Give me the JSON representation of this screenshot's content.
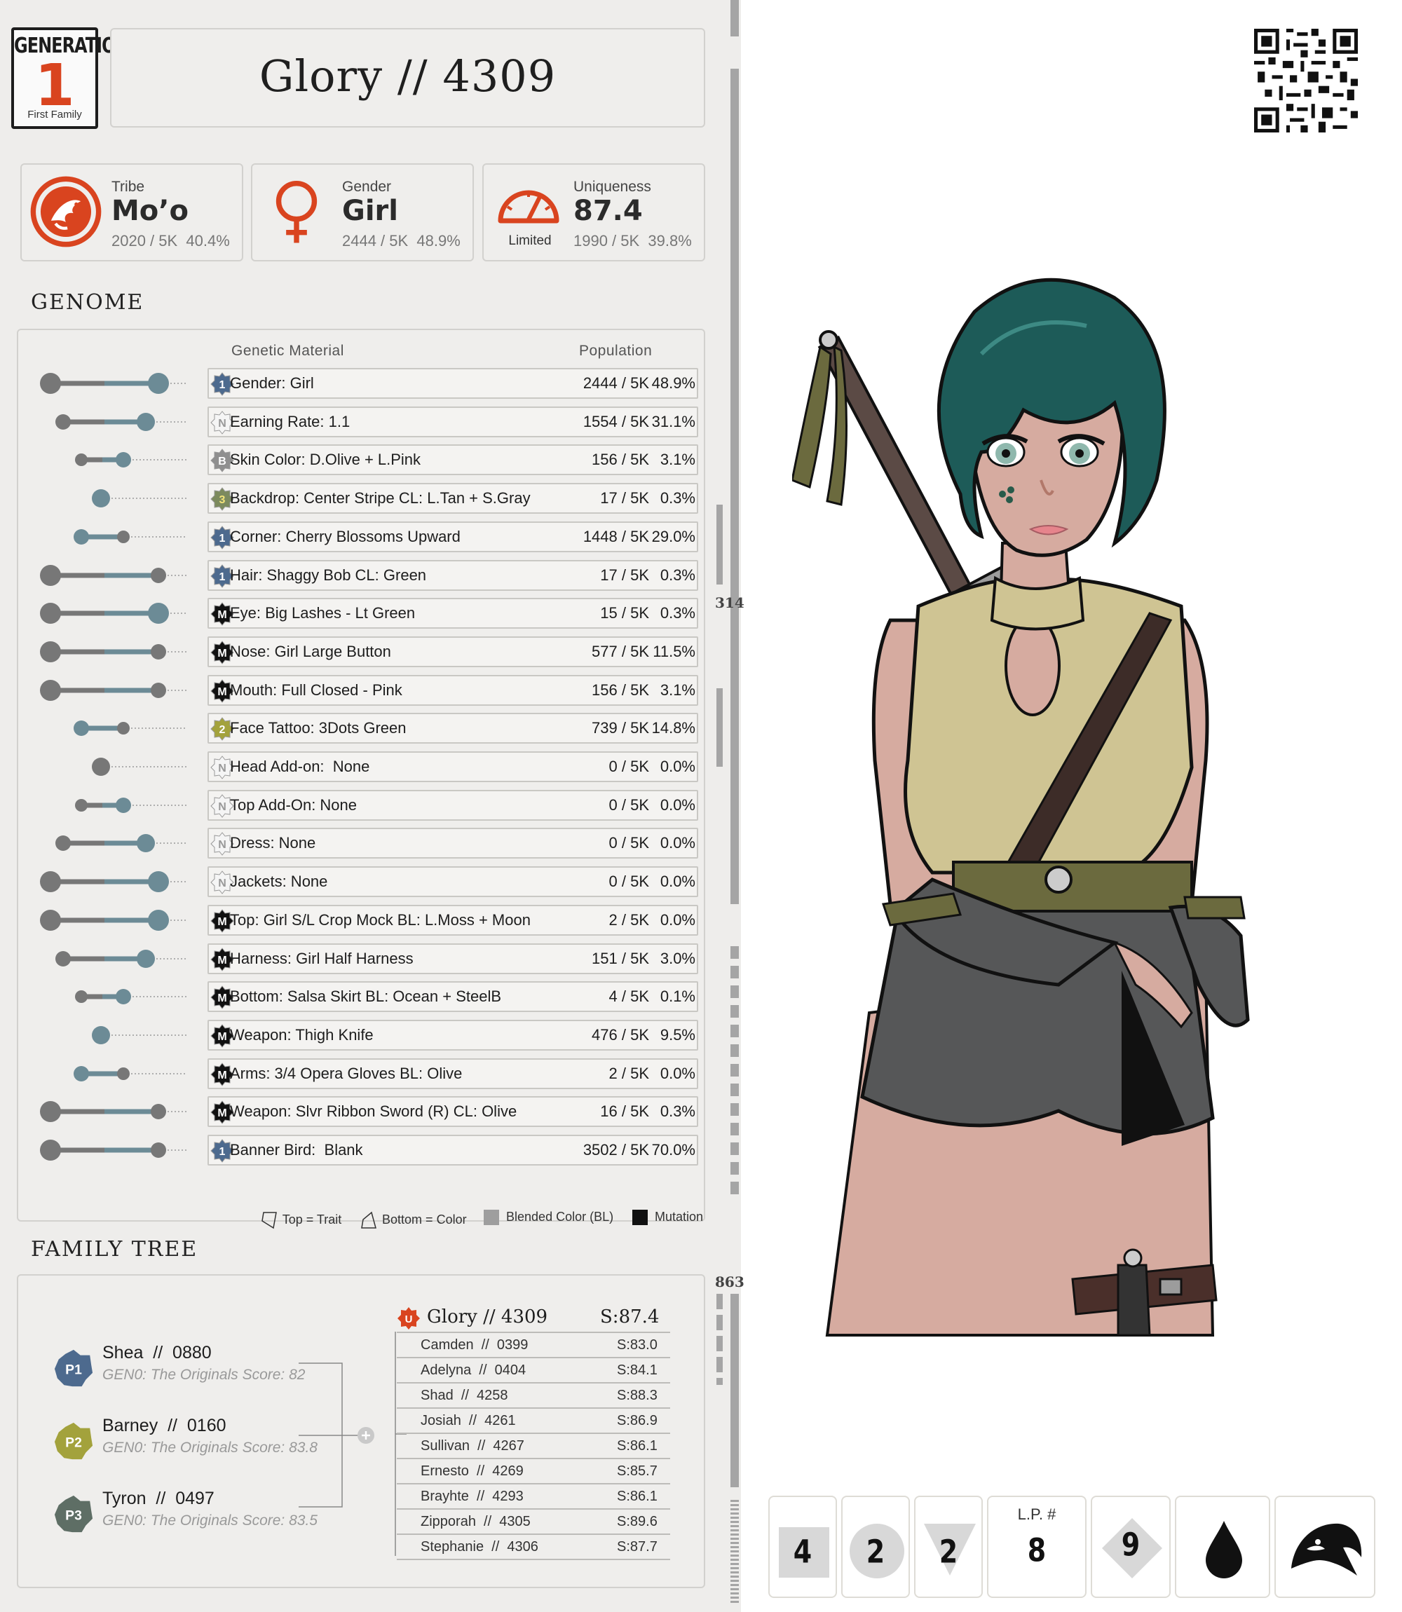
{
  "header": {
    "generation_label": "GENERATION",
    "generation_number": "1",
    "generation_sub": "First Family",
    "title": "Glory // 4309"
  },
  "stats": {
    "tribe": {
      "label": "Tribe",
      "value": "Mo’o",
      "count": "2020 / 5K",
      "pct": "40.4%",
      "icon": "lizard-emblem-icon"
    },
    "gender": {
      "label": "Gender",
      "value": "Girl",
      "count": "2444 / 5K",
      "pct": "48.9%",
      "icon": "female-symbol-icon"
    },
    "uniqueness": {
      "label": "Uniqueness",
      "value": "87.4",
      "count": "1990 / 5K",
      "pct": "39.8%",
      "tier": "Limited",
      "icon": "gauge-icon"
    }
  },
  "genome": {
    "section_title": "GENOME",
    "col_material": "Genetic Material",
    "col_population": "Population",
    "rows": [
      {
        "name": "Gender: Girl",
        "count": "2444 / 5K",
        "pct": "48.9%",
        "badge": "1",
        "badge_color": "#4d6a8e",
        "badge_text": "#ffffff",
        "dots": [
          1,
          0,
          1
        ]
      },
      {
        "name": "Earning Rate: 1.1",
        "count": "1554 / 5K",
        "pct": "31.1%",
        "badge": "N",
        "badge_color": "#f5f5f5",
        "badge_text": "#999999",
        "dots": [
          0,
          1,
          1
        ]
      },
      {
        "name": "Skin Color: D.Olive + L.Pink",
        "count": "156 / 5K",
        "pct": "3.1%",
        "badge": "B",
        "badge_color": "#8f8f8f",
        "badge_text": "#ffffff",
        "dots": [
          0,
          2,
          1
        ]
      },
      {
        "name": "Backdrop: Center Stripe CL: L.Tan + S.Gray",
        "count": "17 / 5K",
        "pct": "0.3%",
        "badge": "3",
        "badge_color": "#7c8a5e",
        "badge_text": "#f2e37a",
        "dots": [
          0,
          3,
          3
        ]
      },
      {
        "name": "Corner: Cherry Blossoms Upward",
        "count": "1448 / 5K",
        "pct": "29.0%",
        "badge": "1",
        "badge_color": "#4d6a8e",
        "badge_text": "#ffffff",
        "dots": [
          2,
          2,
          0
        ]
      },
      {
        "name": "Hair: Shaggy Bob CL: Green",
        "count": "17 / 5K",
        "pct": "0.3%",
        "badge": "1",
        "badge_color": "#4d6a8e",
        "badge_text": "#ffffff",
        "dots": [
          1,
          0,
          0
        ]
      },
      {
        "name": "Eye: Big Lashes - Lt Green",
        "count": "15 / 5K",
        "pct": "0.3%",
        "badge": "M",
        "badge_color": "#111111",
        "badge_text": "#ffffff",
        "dots": [
          1,
          0,
          1
        ]
      },
      {
        "name": "Nose: Girl Large Button",
        "count": "577 / 5K",
        "pct": "11.5%",
        "badge": "M",
        "badge_color": "#111111",
        "badge_text": "#ffffff",
        "dots": [
          1,
          0,
          0
        ]
      },
      {
        "name": "Mouth: Full Closed - Pink",
        "count": "156 / 5K",
        "pct": "3.1%",
        "badge": "M",
        "badge_color": "#111111",
        "badge_text": "#ffffff",
        "dots": [
          1,
          0,
          0
        ]
      },
      {
        "name": "Face Tattoo: 3Dots Green",
        "count": "739 / 5K",
        "pct": "14.8%",
        "badge": "2",
        "badge_color": "#a3a23c",
        "badge_text": "#ffffff",
        "dots": [
          2,
          2,
          0
        ]
      },
      {
        "name": "Head Add-on:  None",
        "count": "0 / 5K",
        "pct": "0.0%",
        "badge": "N",
        "badge_color": "#f5f5f5",
        "badge_text": "#999999",
        "dots": [
          0,
          3,
          4
        ]
      },
      {
        "name": "Top Add-On: None",
        "count": "0 / 5K",
        "pct": "0.0%",
        "badge": "N",
        "badge_color": "#f5f5f5",
        "badge_text": "#999999",
        "dots": [
          0,
          2,
          1
        ]
      },
      {
        "name": "Dress: None",
        "count": "0 / 5K",
        "pct": "0.0%",
        "badge": "N",
        "badge_color": "#f5f5f5",
        "badge_text": "#999999",
        "dots": [
          0,
          1,
          1
        ]
      },
      {
        "name": "Jackets: None",
        "count": "0 / 5K",
        "pct": "0.0%",
        "badge": "N",
        "badge_color": "#f5f5f5",
        "badge_text": "#999999",
        "dots": [
          0,
          0,
          1
        ]
      },
      {
        "name": "Top: Girl S/L Crop Mock BL: L.Moss + Moon",
        "count": "2 / 5K",
        "pct": "0.0%",
        "badge": "M",
        "badge_color": "#111111",
        "badge_text": "#ffffff",
        "dots": [
          0,
          0,
          1
        ]
      },
      {
        "name": "Harness: Girl Half Harness",
        "count": "151 / 5K",
        "pct": "3.0%",
        "badge": "M",
        "badge_color": "#111111",
        "badge_text": "#ffffff",
        "dots": [
          0,
          1,
          1
        ]
      },
      {
        "name": "Bottom: Salsa Skirt BL: Ocean + SteelB",
        "count": "4 / 5K",
        "pct": "0.1%",
        "badge": "M",
        "badge_color": "#111111",
        "badge_text": "#ffffff",
        "dots": [
          0,
          2,
          1
        ]
      },
      {
        "name": "Weapon: Thigh Knife",
        "count": "476 / 5K",
        "pct": "9.5%",
        "badge": "M",
        "badge_color": "#111111",
        "badge_text": "#ffffff",
        "dots": [
          0,
          3,
          3
        ]
      },
      {
        "name": "Arms: 3/4 Opera Gloves BL: Olive",
        "count": "2 / 5K",
        "pct": "0.0%",
        "badge": "M",
        "badge_color": "#111111",
        "badge_text": "#ffffff",
        "dots": [
          2,
          2,
          0
        ]
      },
      {
        "name": "Weapon: Slvr Ribbon Sword (R) CL: Olive",
        "count": "16 / 5K",
        "pct": "0.3%",
        "badge": "M",
        "badge_color": "#111111",
        "badge_text": "#ffffff",
        "dots": [
          1,
          0,
          0
        ]
      },
      {
        "name": "Banner Bird:  Blank",
        "count": "3502 / 5K",
        "pct": "70.0%",
        "badge": "1",
        "badge_color": "#4d6a8e",
        "badge_text": "#ffffff",
        "dots": [
          1,
          0,
          0
        ]
      }
    ],
    "legend": {
      "trait": "Top = Trait",
      "color": "Bottom = Color",
      "blended": "Blended Color (BL)",
      "mutation": "Mutation"
    }
  },
  "family": {
    "section_title": "FAMILY TREE",
    "parents": [
      {
        "tag": "P1",
        "name": "Shea  //  0880",
        "sub": "GEN0: The Originals Score: 82",
        "color": "#4d6a8e"
      },
      {
        "tag": "P2",
        "name": "Barney  //  0160",
        "sub": "GEN0: The Originals Score: 83.8",
        "color": "#a3a23c"
      },
      {
        "tag": "P3",
        "name": "Tyron  //  0497",
        "sub": "GEN0: The Originals Score: 83.5",
        "color": "#5e6e65"
      }
    ],
    "child": {
      "badge": "U",
      "name": "Glory // 4309",
      "score": "S:87.4"
    },
    "siblings": [
      {
        "name": "Camden  //  0399",
        "score": "S:83.0"
      },
      {
        "name": "Adelyna  //  0404",
        "score": "S:84.1"
      },
      {
        "name": "Shad  //  4258",
        "score": "S:88.3"
      },
      {
        "name": "Josiah  //  4261",
        "score": "S:86.9"
      },
      {
        "name": "Sullivan  //  4267",
        "score": "S:86.1"
      },
      {
        "name": "Ernesto  //  4269",
        "score": "S:85.7"
      },
      {
        "name": "Brayhte  //  4293",
        "score": "S:86.1"
      },
      {
        "name": "Zipporah  //  4305",
        "score": "S:89.6"
      },
      {
        "name": "Stephanie  //  4306",
        "score": "S:87.7"
      }
    ]
  },
  "scroll": {
    "marker_a": "314",
    "marker_b": "863"
  },
  "bottom_badges": {
    "square": "4",
    "circle": "2",
    "triangle": "2",
    "lp_label": "L.P. #",
    "lp_value": "8",
    "diamond": "9",
    "drop_icon": "drop-icon",
    "bird_icon": "bird-head-icon"
  },
  "colors": {
    "accent": "#d9441f",
    "panel": "#eeedeb",
    "card_border": "#d2d1ce",
    "blue_badge": "#4d6a8e",
    "olive_badge": "#a3a23c"
  }
}
